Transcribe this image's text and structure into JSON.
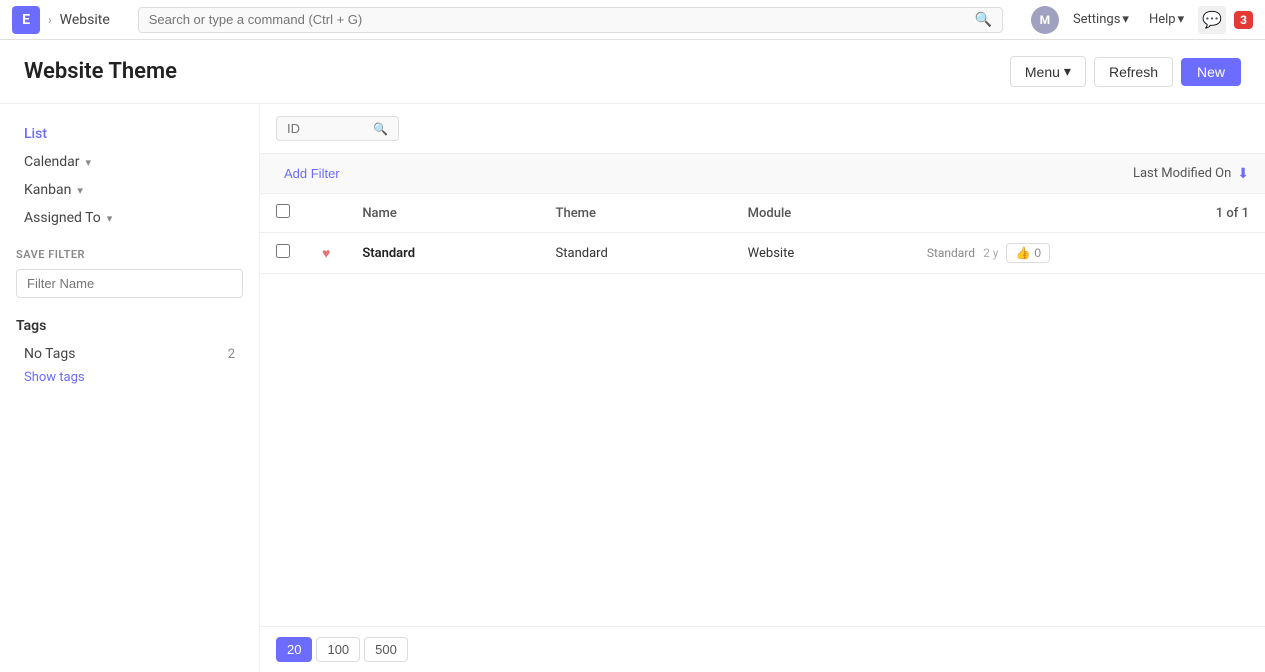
{
  "app": {
    "logo_letter": "E",
    "logo_color": "#6c6cff",
    "breadcrumb_root": "Website",
    "page_title": "Website Theme"
  },
  "navbar": {
    "search_placeholder": "Search or type a command (Ctrl + G)",
    "search_icon": "🔍",
    "avatar_letter": "M",
    "settings_label": "Settings",
    "help_label": "Help",
    "notification_count": "3"
  },
  "toolbar": {
    "menu_label": "Menu",
    "refresh_label": "Refresh",
    "new_label": "New"
  },
  "sidebar": {
    "nav_items": [
      {
        "label": "List",
        "active": true
      },
      {
        "label": "Calendar",
        "has_dropdown": true
      },
      {
        "label": "Kanban",
        "has_dropdown": true
      },
      {
        "label": "Assigned To",
        "has_dropdown": true
      }
    ],
    "save_filter_label": "SAVE FILTER",
    "filter_name_placeholder": "Filter Name",
    "tags_title": "Tags",
    "tags": [
      {
        "label": "No Tags",
        "count": 2
      }
    ],
    "show_tags_label": "Show tags"
  },
  "filter_bar": {
    "id_placeholder": "ID"
  },
  "action_bar": {
    "add_filter_label": "Add Filter",
    "sort_label": "Last Modified On",
    "sort_icon": "⬇"
  },
  "table": {
    "columns": [
      {
        "key": "name",
        "label": "Name"
      },
      {
        "key": "theme",
        "label": "Theme"
      },
      {
        "key": "module",
        "label": "Module"
      }
    ],
    "record_count": "1 of 1",
    "rows": [
      {
        "id": 1,
        "name": "Standard",
        "favorited": true,
        "theme": "Standard",
        "module": "Website",
        "extra": "Standard",
        "time": "2 y",
        "likes": "0"
      }
    ]
  },
  "pagination": {
    "sizes": [
      {
        "value": "20",
        "active": true
      },
      {
        "value": "100",
        "active": false
      },
      {
        "value": "500",
        "active": false
      }
    ]
  }
}
